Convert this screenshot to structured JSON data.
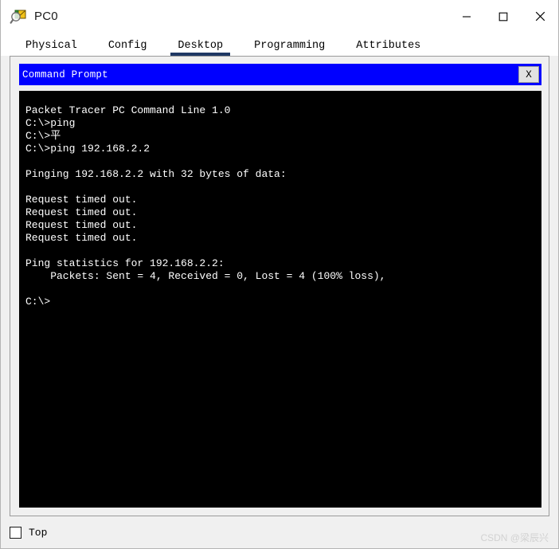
{
  "window": {
    "title": "PC0",
    "icon": "inspect-device-icon",
    "controls": {
      "minimize": "minimize-icon",
      "maximize": "maximize-icon",
      "close": "close-icon"
    }
  },
  "tabs": [
    {
      "label": "Physical",
      "active": false
    },
    {
      "label": "Config",
      "active": false
    },
    {
      "label": "Desktop",
      "active": true
    },
    {
      "label": "Programming",
      "active": false
    },
    {
      "label": "Attributes",
      "active": false
    }
  ],
  "command_prompt": {
    "title": "Command Prompt",
    "close_label": "X",
    "title_bar_color": "#0000FF",
    "terminal_bg": "#000000",
    "terminal_fg": "#FFFFFF",
    "lines": [
      "Packet Tracer PC Command Line 1.0",
      "C:\\>ping",
      "C:\\>平",
      "C:\\>ping 192.168.2.2",
      "",
      "Pinging 192.168.2.2 with 32 bytes of data:",
      "",
      "Request timed out.",
      "Request timed out.",
      "Request timed out.",
      "Request timed out.",
      "",
      "Ping statistics for 192.168.2.2:",
      "    Packets: Sent = 4, Received = 0, Lost = 4 (100% loss),",
      "",
      "C:\\>"
    ]
  },
  "footer": {
    "top_checkbox_label": "Top",
    "top_checkbox_checked": false,
    "watermark": "CSDN @梁辰兴"
  },
  "theme": {
    "accent": "#1F3864",
    "panel_bg": "#F0F0F0",
    "border": "#9A9A9A"
  }
}
